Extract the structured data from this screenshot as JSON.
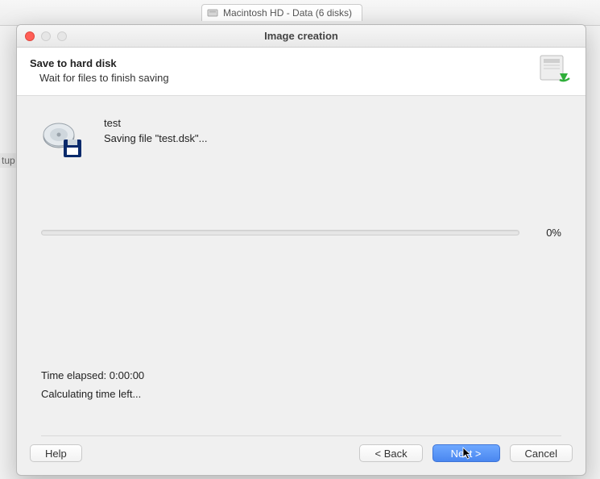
{
  "background": {
    "tab_label": "Macintosh HD - Data (6 disks)",
    "sidebar_item": "tup"
  },
  "window": {
    "title": "Image creation",
    "header": {
      "title": "Save to hard disk",
      "subtitle": "Wait for files to finish saving"
    },
    "file": {
      "name": "test",
      "status": "Saving file \"test.dsk\"..."
    },
    "progress": {
      "percent_label": "0%",
      "percent_value": 0
    },
    "time": {
      "elapsed": "Time elapsed: 0:00:00",
      "remaining": "Calculating time left..."
    },
    "buttons": {
      "help": "Help",
      "back": "< Back",
      "next": "Next >",
      "cancel": "Cancel"
    }
  }
}
